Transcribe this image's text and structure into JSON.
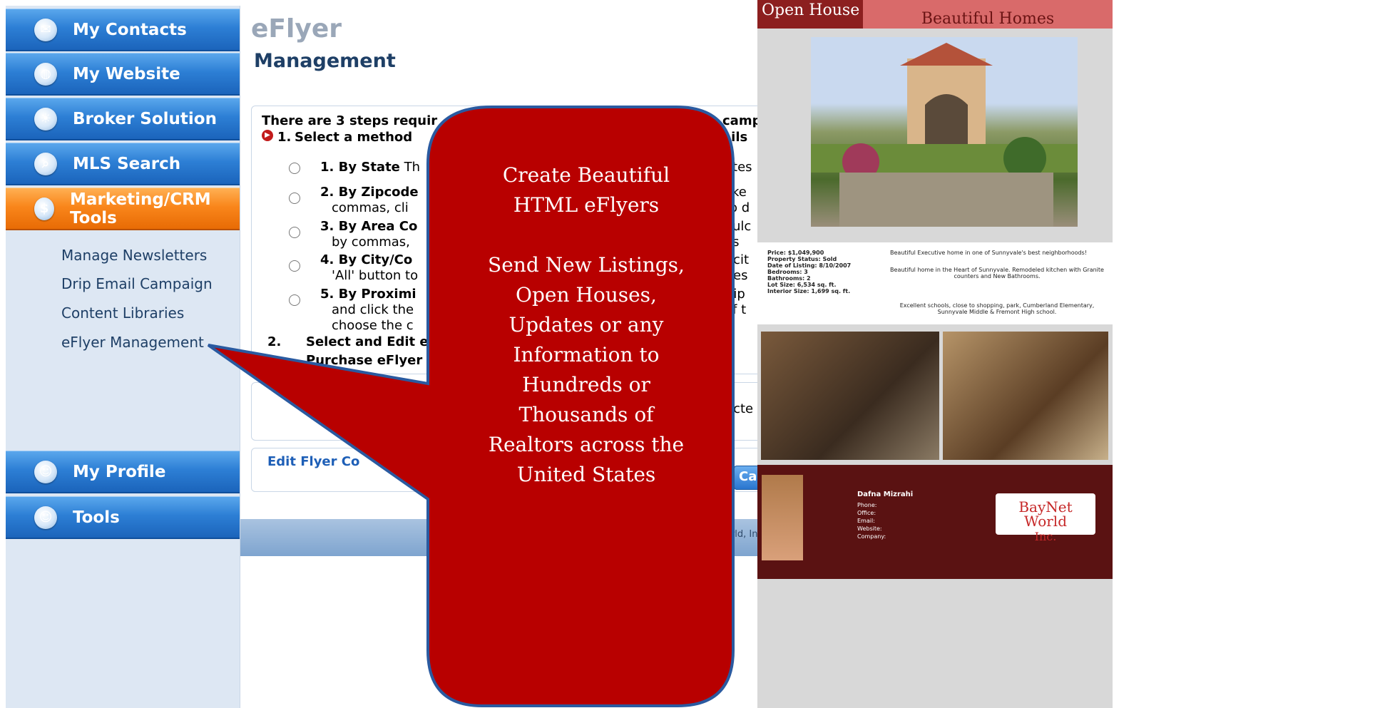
{
  "sidebar": {
    "nav_top": [
      {
        "label": "My Contacts",
        "icon": "contacts-icon"
      },
      {
        "label": "My Website",
        "icon": "globe-icon"
      },
      {
        "label": "Broker Solution",
        "icon": "lightbulb-icon"
      },
      {
        "label": "MLS Search",
        "icon": "search-icon"
      },
      {
        "label": "Marketing/CRM Tools",
        "icon": "marketing-icon",
        "active": true
      }
    ],
    "sub_items": [
      "Manage Newsletters",
      "Drip Email Campaign",
      "Content Libraries",
      "eFlyer Management"
    ],
    "nav_bottom": [
      {
        "label": "My Profile",
        "icon": "user-icon"
      },
      {
        "label": "Tools",
        "icon": "user-icon"
      }
    ]
  },
  "main": {
    "title": "eFlyer",
    "subtitle": "Management",
    "intro": "There are 3 steps requir",
    "intro_tail": "campa",
    "step1": {
      "number": "1.",
      "text": "Select a method",
      "tail": "ails"
    },
    "options": [
      {
        "label": "1. By State",
        "text": " Th",
        "tail": "ates"
      },
      {
        "label": "2. By Zipcode",
        "text": "",
        "line2": "commas, cli",
        "tail": "like",
        "tail2": "to d"
      },
      {
        "label": "3. By Area Co",
        "text": "",
        "line2": "by commas,",
        "tail": "oulc",
        "tail2": "es"
      },
      {
        "label": "4. By City/Co",
        "text": "",
        "line2": "'All' button to",
        "tail": "f cit",
        "tail2": "ties"
      },
      {
        "label": "5. By Proximi",
        "text": "",
        "line2": "and click the",
        "line3": "choose the c",
        "tail": "Zip",
        "tail2": "of t"
      }
    ],
    "step2": {
      "number": "2.",
      "text": "Select and Edit e"
    },
    "purchase_text": "Purchase eFlyer",
    "flyer_box_tail": "ecte",
    "edit_legend": "Edit Flyer Co",
    "cancel_label": "Car",
    "footer_text": "orld, In"
  },
  "callout": {
    "lines": [
      "Create Beautiful",
      "HTML eFlyers",
      "",
      "Send New Listings,",
      "Open Houses,",
      "Updates or any",
      "Information to",
      "Hundreds or",
      "Thousands of",
      "Realtors across the",
      "United States"
    ],
    "fill_color": "#b80000",
    "stroke_color": "#2a5aa0"
  },
  "flyer": {
    "header_left": "Open House",
    "header_right_top": "...",
    "header_right": "Beautiful Homes",
    "price": "Price: $1,049,900",
    "status": "Property Status: Sold",
    "listing_date": "Date of Listing: 8/10/2007",
    "bedrooms": "Bedrooms: 3",
    "bathrooms": "Bathrooms: 2",
    "lot_size": "Lot Size: 6,534 sq. ft.",
    "interior_size": "Interior Size: 1,699 sq. ft.",
    "desc1": "Beautiful Executive home in one of Sunnyvale's best neighborhoods!",
    "desc2": "Beautiful home in the Heart of Sunnyvale. Remodeled kitchen with Granite counters and New Bathrooms.",
    "desc3": "Excellent schools, close to shopping, park, Cumberland Elementary, Sunnyvale Middle & Fremont High school.",
    "agent_name": "Dafna Mizrahi",
    "agent_phone": "Phone:",
    "agent_office": "Office:",
    "agent_email": "Email:",
    "agent_website": "Website:",
    "agent_company": "Company:",
    "logo_line1": "BayNet World",
    "logo_line2": "Inc."
  }
}
